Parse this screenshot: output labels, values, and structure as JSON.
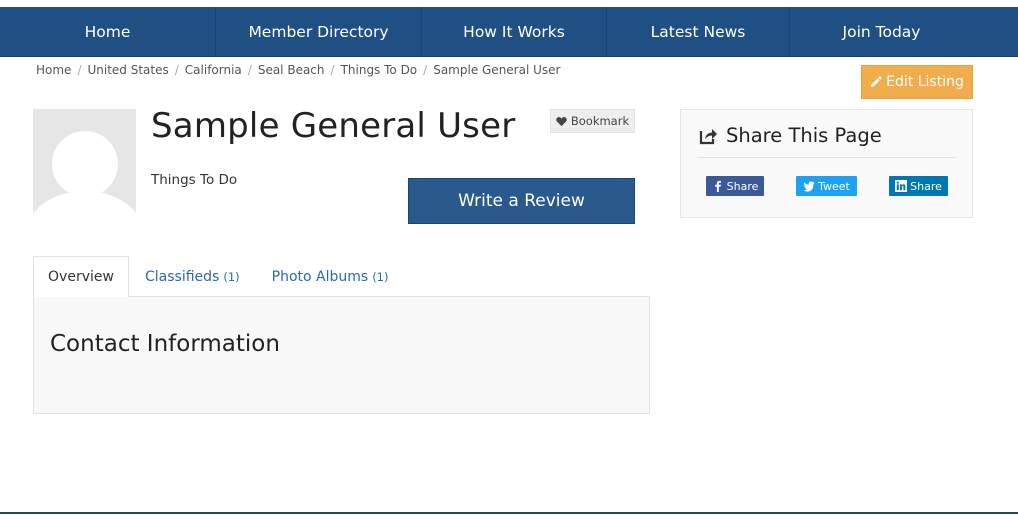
{
  "nav": {
    "items": [
      {
        "label": "Home"
      },
      {
        "label": "Member Directory"
      },
      {
        "label": "How It Works"
      },
      {
        "label": "Latest News"
      },
      {
        "label": "Join Today"
      }
    ]
  },
  "breadcrumb": {
    "items": [
      "Home",
      "United States",
      "California",
      "Seal Beach",
      "Things To Do",
      "Sample General User"
    ],
    "separator": "/"
  },
  "edit_listing": {
    "label": "Edit Listing",
    "icon": "pencil-icon"
  },
  "profile": {
    "name": "Sample General User",
    "category": "Things To Do",
    "bookmark_label": "Bookmark",
    "write_review_label": "Write a Review"
  },
  "share": {
    "title": "Share This Page",
    "buttons": {
      "facebook": "Share",
      "twitter": "Tweet",
      "linkedin": "Share"
    }
  },
  "tabs": [
    {
      "label": "Overview",
      "count": ""
    },
    {
      "label": "Classifieds",
      "count": "(1)"
    },
    {
      "label": "Photo Albums",
      "count": "(1)"
    }
  ],
  "content": {
    "heading": "Contact Information"
  },
  "colors": {
    "nav_bg": "#1f4f83",
    "edit_bg": "#f0ad4e",
    "review_bg": "#2a5a8c",
    "facebook": "#3b5998",
    "twitter": "#1da1f2",
    "linkedin": "#0077b5",
    "link": "#2a6aa8"
  }
}
